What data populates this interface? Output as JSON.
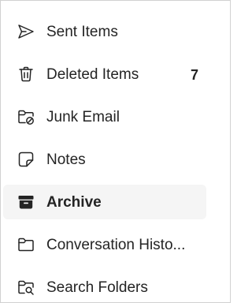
{
  "folders": [
    {
      "label": "Sent Items",
      "icon": "send-icon"
    },
    {
      "label": "Deleted Items",
      "icon": "trash-icon",
      "count": "7"
    },
    {
      "label": "Junk Email",
      "icon": "folder-prohibited-icon"
    },
    {
      "label": "Notes",
      "icon": "note-icon"
    },
    {
      "label": "Archive",
      "icon": "archive-icon",
      "selected": true
    },
    {
      "label": "Conversation Histo...",
      "icon": "folder-icon"
    },
    {
      "label": "Search Folders",
      "icon": "folder-search-icon"
    }
  ],
  "colors": {
    "text": "#242424",
    "selected_background": "#f5f5f5",
    "border": "#d1d1d1"
  }
}
